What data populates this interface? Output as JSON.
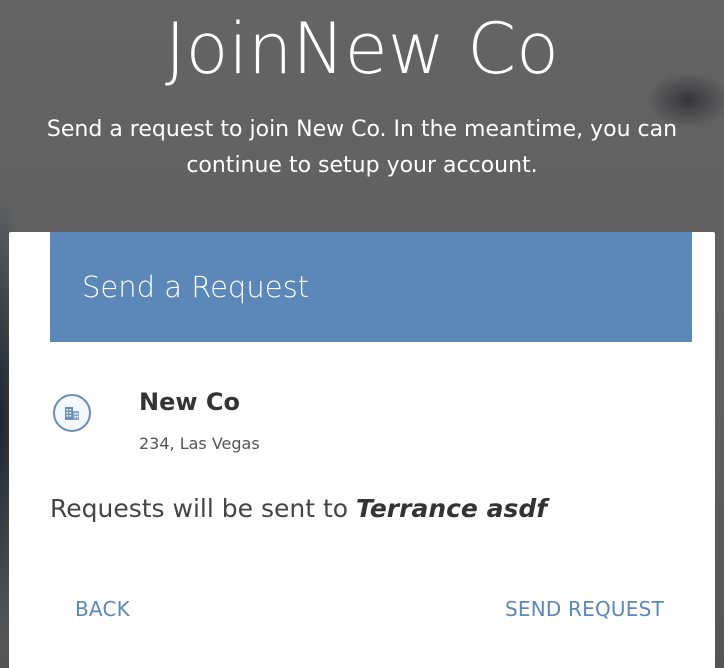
{
  "hero": {
    "title": "JoinNew Co",
    "subtitle": "Send a request to join New Co. In the meantime, you can continue to setup your account."
  },
  "card": {
    "header_title": "Send a Request",
    "company": {
      "icon": "building-icon",
      "name": "New Co",
      "address": "234, Las Vegas"
    },
    "request_prefix": "Requests will be sent to ",
    "request_recipient": "Terrance asdf"
  },
  "actions": {
    "back_label": "BACK",
    "send_label": "SEND REQUEST"
  },
  "colors": {
    "accent": "#5b88b9",
    "backdrop": "#5e5e5e",
    "card": "#ffffff"
  }
}
